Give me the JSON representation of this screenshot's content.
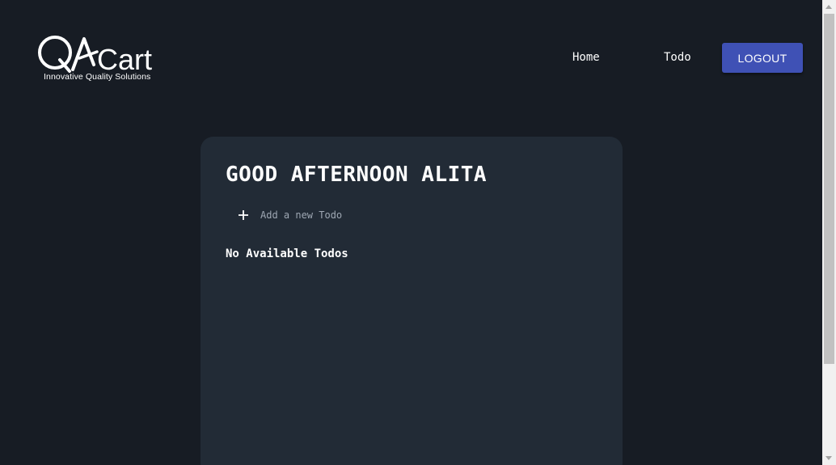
{
  "brand": {
    "logo_text": "QACart",
    "tagline": "Innovative Quality Solutions"
  },
  "nav": {
    "home_label": "Home",
    "todo_label": "Todo",
    "logout_label": "LOGOUT"
  },
  "main": {
    "greeting": "GOOD AFTERNOON ALITA",
    "add_todo_label": "Add a new Todo",
    "empty_message": "No Available Todos"
  },
  "icons": {
    "add": "plus-icon",
    "logo": "qacart-logo"
  },
  "colors": {
    "background": "#171c24",
    "card": "#222b36",
    "logout_button": "#3f51b5",
    "muted_text": "#9ea7b3"
  }
}
